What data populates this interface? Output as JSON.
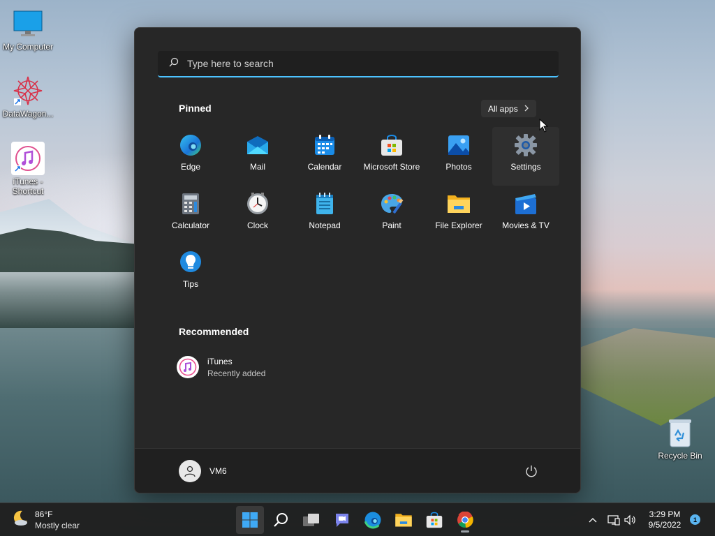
{
  "desktop": {
    "icons": [
      {
        "label": "My Computer"
      },
      {
        "label": "DataWagon..."
      },
      {
        "label": "iTunes - Shortcut"
      },
      {
        "label": "Recycle Bin"
      }
    ]
  },
  "start_menu": {
    "search_placeholder": "Type here to search",
    "pinned_title": "Pinned",
    "all_apps_label": "All apps",
    "pinned_apps": [
      {
        "label": "Edge"
      },
      {
        "label": "Mail"
      },
      {
        "label": "Calendar"
      },
      {
        "label": "Microsoft Store"
      },
      {
        "label": "Photos"
      },
      {
        "label": "Settings"
      },
      {
        "label": "Calculator"
      },
      {
        "label": "Clock"
      },
      {
        "label": "Notepad"
      },
      {
        "label": "Paint"
      },
      {
        "label": "File Explorer"
      },
      {
        "label": "Movies & TV"
      },
      {
        "label": "Tips"
      }
    ],
    "recommended_title": "Recommended",
    "recommended": [
      {
        "name": "iTunes",
        "sub": "Recently added"
      }
    ],
    "user_name": "VM6"
  },
  "taskbar": {
    "weather_temp": "86°F",
    "weather_desc": "Mostly clear",
    "time": "3:29 PM",
    "date": "9/5/2022",
    "notification_count": "1"
  },
  "colors": {
    "accent": "#4cc2ff",
    "start_bg": "#272727",
    "taskbar_bg": "#202020"
  }
}
